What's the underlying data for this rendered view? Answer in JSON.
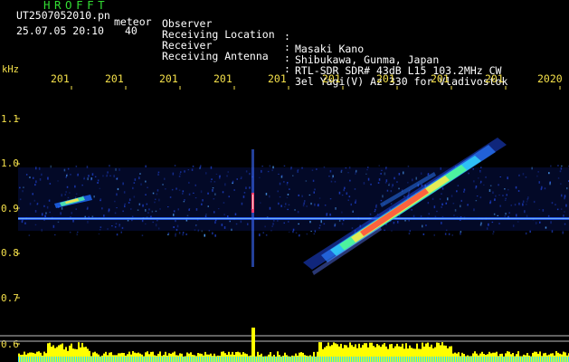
{
  "header": {
    "logo": "HROFFT",
    "file_name": "UT2507052010.pn",
    "mode": "meteor",
    "timestamp": "25.07.05 20:10",
    "count": "40"
  },
  "info": [
    {
      "label": "Observer",
      "value": "Masaki Kano"
    },
    {
      "label": "Receiving Location",
      "value": "Shibukawa, Gunma, Japan"
    },
    {
      "label": "Receiver",
      "value": "RTL-SDR SDR# 43dB L15 103.2MHz CW"
    },
    {
      "label": "Receiving Antenna",
      "value": "3el Yagi(V) Az 330 for Vladivostok"
    }
  ],
  "axis": {
    "y_unit": "kHz",
    "x_ticks": [
      "201",
      "201",
      "201",
      "201",
      "201",
      "201",
      "201",
      "201",
      "201",
      "2020"
    ],
    "y_ticks": [
      "1.1",
      "1.0",
      "0.9",
      "0.8",
      "0.7",
      "0.6"
    ]
  },
  "colors": {
    "background": "#000000",
    "title_green": "#33dd33",
    "tick_yellow": "#f4e04a",
    "text_white": "#ffffff",
    "noise_blue": "#1e4bd8",
    "echo_red": "#ff3030",
    "histogram_yellow": "#ffff00",
    "histogram_cyan": "#33ddee"
  }
}
